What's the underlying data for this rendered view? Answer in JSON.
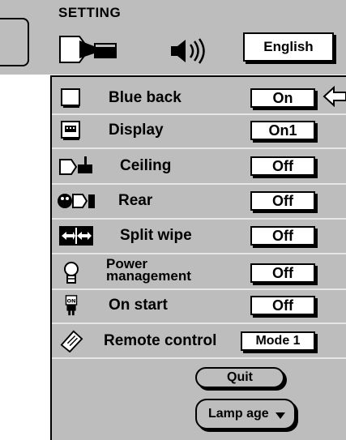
{
  "header": {
    "title": "SETTING",
    "language_value": "English",
    "icons": [
      "projector-icon",
      "speaker-icon"
    ]
  },
  "menu": {
    "items": [
      {
        "label": "Blue back",
        "value": "On",
        "icon": "blue-back-icon"
      },
      {
        "label": "Display",
        "value": "On1",
        "icon": "display-icon"
      },
      {
        "label": "Ceiling",
        "value": "Off",
        "icon": "ceiling-icon"
      },
      {
        "label": "Rear",
        "value": "Off",
        "icon": "rear-icon"
      },
      {
        "label": "Split wipe",
        "value": "Off",
        "icon": "split-wipe-icon"
      },
      {
        "label_line1": "Power",
        "label_line2": "management",
        "value": "Off",
        "icon": "power-management-icon"
      },
      {
        "label": "On start",
        "value": "Off",
        "icon": "on-start-icon"
      },
      {
        "label": "Remote control",
        "value": "Mode 1",
        "icon": "remote-control-icon"
      }
    ],
    "quit_label": "Quit",
    "lamp_age_label": "Lamp age"
  }
}
